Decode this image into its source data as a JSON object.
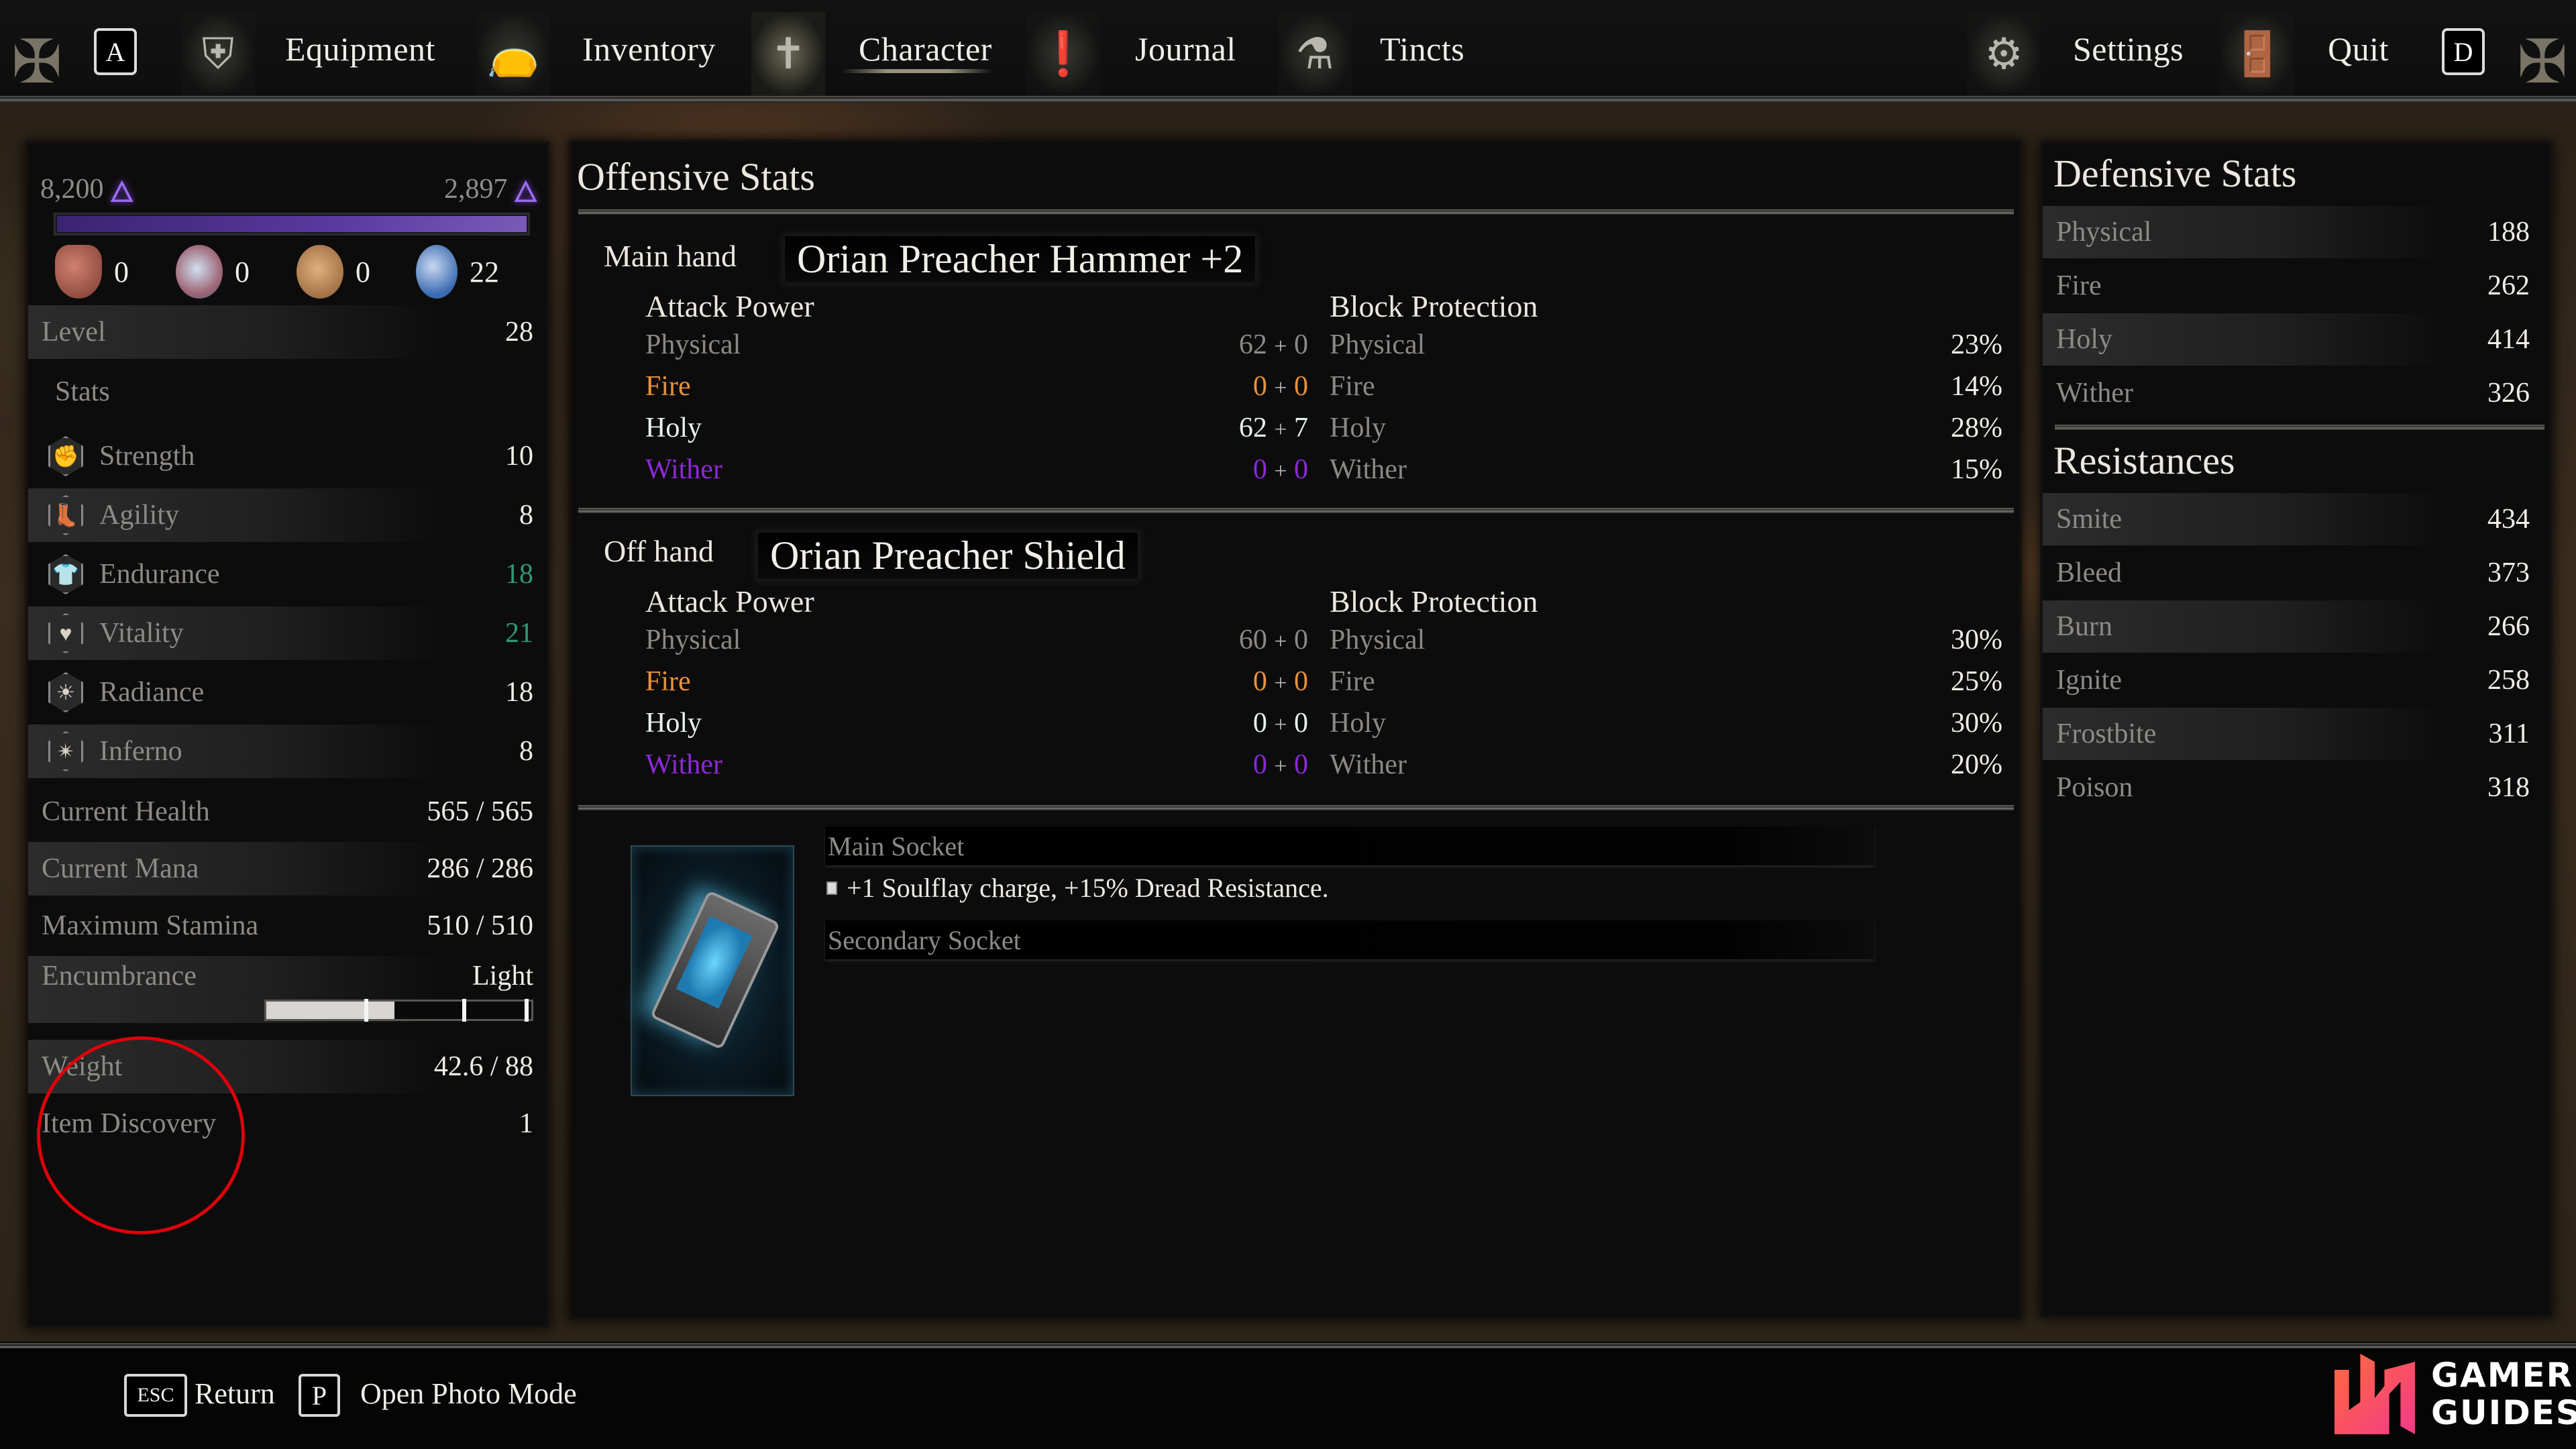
{
  "nav": {
    "left_key": "A",
    "right_key": "D",
    "tabs": [
      {
        "label": "Equipment",
        "icon": "shield-sword-icon",
        "active": false
      },
      {
        "label": "Inventory",
        "icon": "pouch-icon",
        "active": false
      },
      {
        "label": "Character",
        "icon": "character-crest-icon",
        "active": true
      },
      {
        "label": "Journal",
        "icon": "journal-exclamation-icon",
        "active": false
      },
      {
        "label": "Tincts",
        "icon": "tincts-flasks-icon",
        "active": false
      }
    ],
    "settings_label": "Settings",
    "quit_label": "Quit"
  },
  "left_panel": {
    "currency_left": "8,200",
    "currency_right": "2,897",
    "xp_progress": 1.0,
    "resources": [
      {
        "icon": "hand-icon",
        "value": "0"
      },
      {
        "icon": "eye-orb-icon",
        "value": "0"
      },
      {
        "icon": "ember-stone-icon",
        "value": "0"
      },
      {
        "icon": "blue-shell-icon",
        "value": "22"
      }
    ],
    "level_label": "Level",
    "level_value": "28",
    "stats_heading": "Stats",
    "stats": [
      {
        "label": "Strength",
        "value": "10",
        "icon": "fist-icon",
        "boosted": false
      },
      {
        "label": "Agility",
        "value": "8",
        "icon": "boot-icon",
        "boosted": false
      },
      {
        "label": "Endurance",
        "value": "18",
        "icon": "armor-icon",
        "boosted": true
      },
      {
        "label": "Vitality",
        "value": "21",
        "icon": "heart-icon",
        "boosted": true
      },
      {
        "label": "Radiance",
        "value": "18",
        "icon": "sun-icon",
        "boosted": false
      },
      {
        "label": "Inferno",
        "value": "8",
        "icon": "inferno-icon",
        "boosted": false
      }
    ],
    "attributes": [
      {
        "label": "Current Health",
        "value": "565 / 565"
      },
      {
        "label": "Current Mana",
        "value": "286 / 286"
      },
      {
        "label": "Maximum Stamina",
        "value": "510 / 510"
      }
    ],
    "encumbrance_label": "Encumbrance",
    "encumbrance_value": "Light",
    "encumbrance_fill": 0.484,
    "weight_label": "Weight",
    "weight_value": "42.6 / 88",
    "item_discovery_label": "Item Discovery",
    "item_discovery_value": "1"
  },
  "offensive": {
    "title": "Offensive Stats",
    "main_hand": {
      "slot_label": "Main hand",
      "item_name": "Orian Preacher Hammer +2",
      "attack_heading": "Attack Power",
      "block_heading": "Block Protection",
      "attack": [
        {
          "label": "Physical",
          "base": "62",
          "bonus": "0"
        },
        {
          "label": "Fire",
          "base": "0",
          "bonus": "0"
        },
        {
          "label": "Holy",
          "base": "62",
          "bonus": "7"
        },
        {
          "label": "Wither",
          "base": "0",
          "bonus": "0"
        }
      ],
      "block": [
        {
          "label": "Physical",
          "value": "23%"
        },
        {
          "label": "Fire",
          "value": "14%"
        },
        {
          "label": "Holy",
          "value": "28%"
        },
        {
          "label": "Wither",
          "value": "15%"
        }
      ]
    },
    "off_hand": {
      "slot_label": "Off hand",
      "item_name": "Orian Preacher Shield",
      "attack_heading": "Attack Power",
      "block_heading": "Block Protection",
      "attack": [
        {
          "label": "Physical",
          "base": "60",
          "bonus": "0"
        },
        {
          "label": "Fire",
          "base": "0",
          "bonus": "0"
        },
        {
          "label": "Holy",
          "base": "0",
          "bonus": "0"
        },
        {
          "label": "Wither",
          "base": "0",
          "bonus": "0"
        }
      ],
      "block": [
        {
          "label": "Physical",
          "value": "30%"
        },
        {
          "label": "Fire",
          "value": "25%"
        },
        {
          "label": "Holy",
          "value": "30%"
        },
        {
          "label": "Wither",
          "value": "20%"
        }
      ]
    },
    "sockets": {
      "main_label": "Main Socket",
      "main_effect": "+1 Soulflay charge, +15% Dread Resistance.",
      "secondary_label": "Secondary Socket",
      "gem_icon": "soul-lantern-rune-icon"
    }
  },
  "defensive": {
    "title": "Defensive Stats",
    "stats": [
      {
        "label": "Physical",
        "value": "188"
      },
      {
        "label": "Fire",
        "value": "262"
      },
      {
        "label": "Holy",
        "value": "414"
      },
      {
        "label": "Wither",
        "value": "326"
      }
    ],
    "resistances_title": "Resistances",
    "resistances": [
      {
        "label": "Smite",
        "value": "434"
      },
      {
        "label": "Bleed",
        "value": "373"
      },
      {
        "label": "Burn",
        "value": "266"
      },
      {
        "label": "Ignite",
        "value": "258"
      },
      {
        "label": "Frostbite",
        "value": "311"
      },
      {
        "label": "Poison",
        "value": "318"
      }
    ]
  },
  "footer": {
    "esc_key": "ESC",
    "return_label": "Return",
    "photo_key": "P",
    "photo_label": "Open Photo Mode",
    "watermark_line1": "GAMER",
    "watermark_line2": "GUIDES"
  },
  "colors": {
    "fire": "#e8923c",
    "holy": "#e6f2f2",
    "wither": "#8a2ad6",
    "boosted_stat": "#2f9a72",
    "soul_currency": "#9a6cf0",
    "annotation_circle": "#e0000a"
  }
}
